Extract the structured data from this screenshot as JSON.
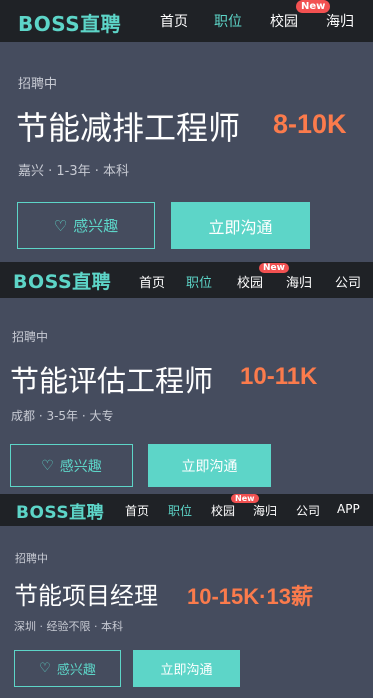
{
  "cards": [
    {
      "logo": "BOSS直聘",
      "nav": [
        "首页",
        "职位",
        "校园",
        "海归"
      ],
      "badge": "New",
      "status": "招聘中",
      "title": "节能减排工程师",
      "salary": "8-10K",
      "meta": "嘉兴 · 1-3年 · 本科",
      "interest": "感兴趣",
      "chat": "立即沟通"
    },
    {
      "logo": "BOSS直聘",
      "nav": [
        "首页",
        "职位",
        "校园",
        "海归",
        "公司"
      ],
      "badge": "New",
      "status": "招聘中",
      "title": "节能评估工程师",
      "salary": "10-11K",
      "meta": "成都 · 3-5年 · 大专",
      "interest": "感兴趣",
      "chat": "立即沟通"
    },
    {
      "logo": "BOSS直聘",
      "nav": [
        "首页",
        "职位",
        "校园",
        "海归",
        "公司",
        "APP"
      ],
      "badge": "New",
      "status": "招聘中",
      "title": "节能项目经理",
      "salary": "10-15K·13薪",
      "meta": "深圳 · 经验不限 · 本科",
      "interest": "感兴趣",
      "chat": "立即沟通"
    }
  ],
  "colors": {
    "accent": "#5dd5c8",
    "salary": "#fb7b4c",
    "nav_bg": "#1f2226",
    "card_bg": "#454c5e",
    "badge": "#f25151"
  },
  "icons": {
    "interest": "heart-outline-icon"
  }
}
